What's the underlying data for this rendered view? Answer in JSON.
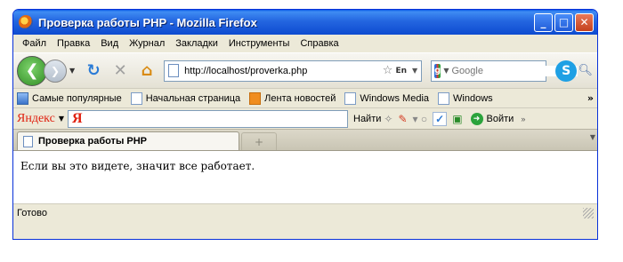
{
  "window": {
    "title": "Проверка работы PHP - Mozilla Firefox",
    "controls": {
      "minimize": "_",
      "maximize": "□",
      "close": "✕"
    }
  },
  "menubar": {
    "items": [
      "Файл",
      "Правка",
      "Вид",
      "Журнал",
      "Закладки",
      "Инструменты",
      "Справка"
    ]
  },
  "navbar": {
    "back": "❮",
    "forward": "❯",
    "url": "http://localhost/proverka.php",
    "lang_indicator": "En",
    "search_placeholder": "Google"
  },
  "bookmarks": {
    "items": [
      "Самые популярные",
      "Начальная страница",
      "Лента новостей",
      "Windows Media",
      "Windows"
    ],
    "more": "»"
  },
  "yandex_bar": {
    "brand": "Яндекс",
    "logo": "Я",
    "find": "Найти",
    "login": "Войти"
  },
  "tabs": {
    "active_title": "Проверка работы PHP",
    "new_tab": "+"
  },
  "page": {
    "text": "Если вы это видете, значит все работает."
  },
  "status": {
    "text": "Готово"
  }
}
